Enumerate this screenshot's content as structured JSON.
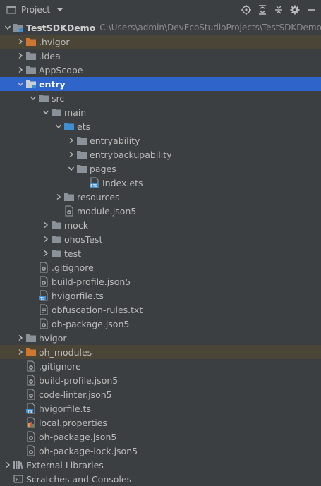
{
  "header": {
    "title": "Project"
  },
  "root": {
    "name": "TestSDKDemo",
    "path": "C:\\Users\\admin\\DevEcoStudioProjects\\TestSDKDemo"
  },
  "tree": [
    {
      "label": ".hvigor",
      "depth": 1,
      "arrow": "right",
      "icon": "folder-orange",
      "state": "excluded"
    },
    {
      "label": ".idea",
      "depth": 1,
      "arrow": "right",
      "icon": "folder-gray"
    },
    {
      "label": "AppScope",
      "depth": 1,
      "arrow": "right",
      "icon": "folder-gray"
    },
    {
      "label": "entry",
      "depth": 1,
      "arrow": "down",
      "icon": "folder-module",
      "state": "selected"
    },
    {
      "label": "src",
      "depth": 2,
      "arrow": "down",
      "icon": "folder-gray"
    },
    {
      "label": "main",
      "depth": 3,
      "arrow": "down",
      "icon": "folder-gray"
    },
    {
      "label": "ets",
      "depth": 4,
      "arrow": "down",
      "icon": "folder-blue"
    },
    {
      "label": "entryability",
      "depth": 5,
      "arrow": "right",
      "icon": "folder-gray"
    },
    {
      "label": "entrybackupability",
      "depth": 5,
      "arrow": "right",
      "icon": "folder-gray"
    },
    {
      "label": "pages",
      "depth": 5,
      "arrow": "down",
      "icon": "folder-gray"
    },
    {
      "label": "Index.ets",
      "depth": 6,
      "arrow": "none",
      "icon": "file-ets"
    },
    {
      "label": "resources",
      "depth": 4,
      "arrow": "right",
      "icon": "folder-gray"
    },
    {
      "label": "module.json5",
      "depth": 4,
      "arrow": "none",
      "icon": "file-gear"
    },
    {
      "label": "mock",
      "depth": 3,
      "arrow": "right",
      "icon": "folder-gray"
    },
    {
      "label": "ohosTest",
      "depth": 3,
      "arrow": "right",
      "icon": "folder-gray"
    },
    {
      "label": "test",
      "depth": 3,
      "arrow": "right",
      "icon": "folder-gray"
    },
    {
      "label": ".gitignore",
      "depth": 2,
      "arrow": "none",
      "icon": "file-gear"
    },
    {
      "label": "build-profile.json5",
      "depth": 2,
      "arrow": "none",
      "icon": "file-gear"
    },
    {
      "label": "hvigorfile.ts",
      "depth": 2,
      "arrow": "none",
      "icon": "file-ts"
    },
    {
      "label": "obfuscation-rules.txt",
      "depth": 2,
      "arrow": "none",
      "icon": "file-text"
    },
    {
      "label": "oh-package.json5",
      "depth": 2,
      "arrow": "none",
      "icon": "file-gear"
    },
    {
      "label": "hvigor",
      "depth": 1,
      "arrow": "right",
      "icon": "folder-gray"
    },
    {
      "label": "oh_modules",
      "depth": 1,
      "arrow": "right",
      "icon": "folder-orange",
      "state": "excluded"
    },
    {
      "label": ".gitignore",
      "depth": 1,
      "arrow": "none",
      "icon": "file-gear"
    },
    {
      "label": "build-profile.json5",
      "depth": 1,
      "arrow": "none",
      "icon": "file-gear"
    },
    {
      "label": "code-linter.json5",
      "depth": 1,
      "arrow": "none",
      "icon": "file-gear"
    },
    {
      "label": "hvigorfile.ts",
      "depth": 1,
      "arrow": "none",
      "icon": "file-ts"
    },
    {
      "label": "local.properties",
      "depth": 1,
      "arrow": "none",
      "icon": "file-properties"
    },
    {
      "label": "oh-package.json5",
      "depth": 1,
      "arrow": "none",
      "icon": "file-gear"
    },
    {
      "label": "oh-package-lock.json5",
      "depth": 1,
      "arrow": "none",
      "icon": "file-gear"
    },
    {
      "label": "External Libraries",
      "depth": 0,
      "arrow": "right",
      "icon": "libraries"
    },
    {
      "label": "Scratches and Consoles",
      "depth": 0,
      "arrow": "none",
      "icon": "scratches"
    }
  ],
  "colors": {
    "background": "#3c3f41",
    "selected": "#2f65ca",
    "excluded": "#4a4536",
    "folder_gray": "#8a9198",
    "folder_orange": "#cc7832",
    "folder_blue": "#3d8fd1"
  }
}
